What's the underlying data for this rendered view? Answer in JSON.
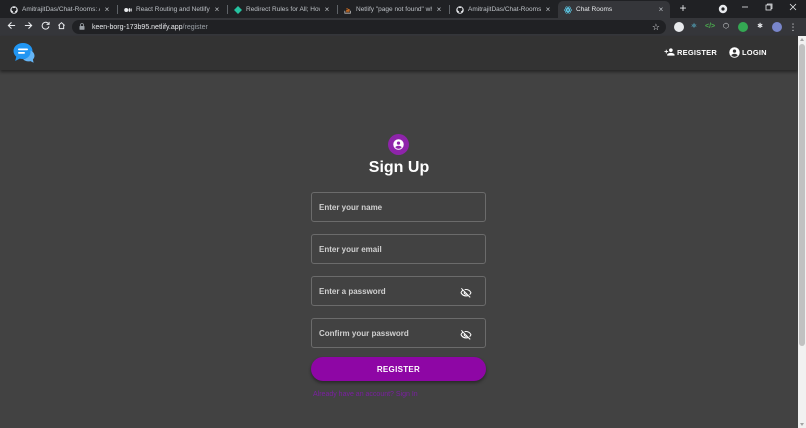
{
  "browser": {
    "tabs": [
      {
        "title": "AmitrajitDas/Chat-Rooms: A",
        "icon": "github-icon"
      },
      {
        "title": "React Routing and Netlify R",
        "icon": "medium-icon"
      },
      {
        "title": "Redirect Rules for All; How",
        "icon": "netlify-icon"
      },
      {
        "title": "Netlify \"page not found\" wh",
        "icon": "stackoverflow-icon"
      },
      {
        "title": "AmitrajitDas/Chat-Rooms: A",
        "icon": "github-icon"
      },
      {
        "title": "Chat Rooms",
        "icon": "react-icon"
      }
    ],
    "close_glyph": "×",
    "new_tab_glyph": "+",
    "address": {
      "host": "keen-borg-173b95.netlify.app",
      "path": "/register"
    }
  },
  "appbar": {
    "register_label": "REGISTER",
    "login_label": "LOGIN"
  },
  "form": {
    "heading": "Sign Up",
    "name_placeholder": "Enter your name",
    "email_placeholder": "Enter your email",
    "password_placeholder": "Enter a password",
    "confirm_placeholder": "Confirm your password",
    "submit_label": "REGISTER",
    "signin_link": "Already have an account? Sign In"
  },
  "colors": {
    "accent": "#8e06a5",
    "page_bg": "#424242",
    "appbar_bg": "#333333",
    "logo_blue": "#2196f3"
  }
}
